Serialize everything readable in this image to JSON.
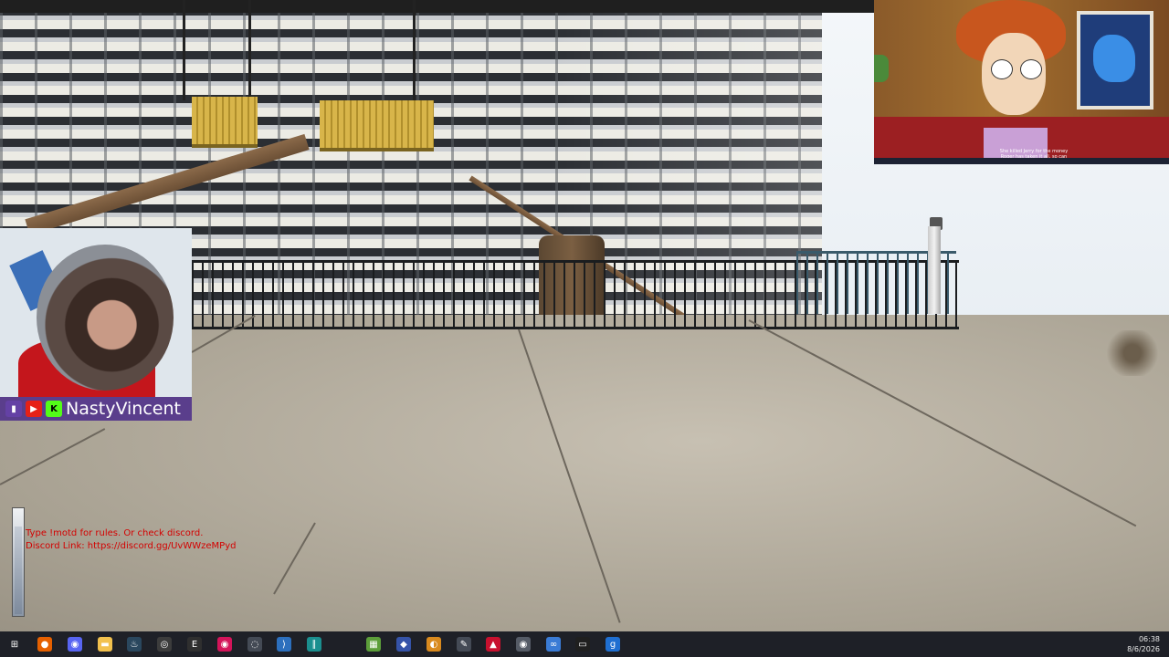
{
  "streamer": {
    "name": "NastyVincent",
    "socials": [
      {
        "icon": "twitch-icon",
        "color": "#6441a5"
      },
      {
        "icon": "youtube-icon",
        "color": "#e62117"
      },
      {
        "icon": "kick-icon",
        "color": "#53fc18"
      }
    ]
  },
  "chat": {
    "line1": "Type !motd for rules. Or check discord.",
    "line2": "Discord Link: https://discord.gg/UvWWzeMPyd",
    "color": "#d40000"
  },
  "overlay_video": {
    "subtitle_line1": "She killed Jerry for the money",
    "subtitle_line2": "Roger has taken it all, so can"
  },
  "taskbar": {
    "icons": [
      {
        "name": "start-icon",
        "glyph": "⊞",
        "color": "#1e2027"
      },
      {
        "name": "firefox-icon",
        "glyph": "●",
        "color": "#e66000"
      },
      {
        "name": "discord-icon",
        "glyph": "◉",
        "color": "#5865f2"
      },
      {
        "name": "file-explorer-icon",
        "glyph": "▬",
        "color": "#f2c14e"
      },
      {
        "name": "steam-icon",
        "glyph": "♨",
        "color": "#2a475e"
      },
      {
        "name": "obs-icon",
        "glyph": "◎",
        "color": "#3c3c3c"
      },
      {
        "name": "epic-games-icon",
        "glyph": "E",
        "color": "#2f2f2f"
      },
      {
        "name": "record-app-icon",
        "glyph": "◉",
        "color": "#d4145a"
      },
      {
        "name": "utility-app-icon",
        "glyph": "◌",
        "color": "#444a55"
      },
      {
        "name": "vscode-icon",
        "glyph": "⟩",
        "color": "#2c6fbd"
      },
      {
        "name": "library-app-icon",
        "glyph": "∥",
        "color": "#1b8f8f"
      },
      {
        "name": "minecraft-icon",
        "glyph": "▦",
        "color": "#5c9e3a"
      },
      {
        "name": "shield-app-icon",
        "glyph": "◆",
        "color": "#3553a8"
      },
      {
        "name": "game-launcher-icon",
        "glyph": "◐",
        "color": "#d98a1e"
      },
      {
        "name": "pen-app-icon",
        "glyph": "✎",
        "color": "#444a55"
      },
      {
        "name": "adobe-app-icon",
        "glyph": "▲",
        "color": "#c8102e"
      },
      {
        "name": "chrome-app-icon",
        "glyph": "◉",
        "color": "#555b66"
      },
      {
        "name": "network-app-icon",
        "glyph": "∞",
        "color": "#3a7bd5"
      },
      {
        "name": "terminal-icon",
        "glyph": "▭",
        "color": "#1f1f1f"
      },
      {
        "name": "garrysmod-icon",
        "glyph": "g",
        "color": "#1f6fd1"
      }
    ],
    "time": "06:38",
    "date": "8/6/2026"
  }
}
